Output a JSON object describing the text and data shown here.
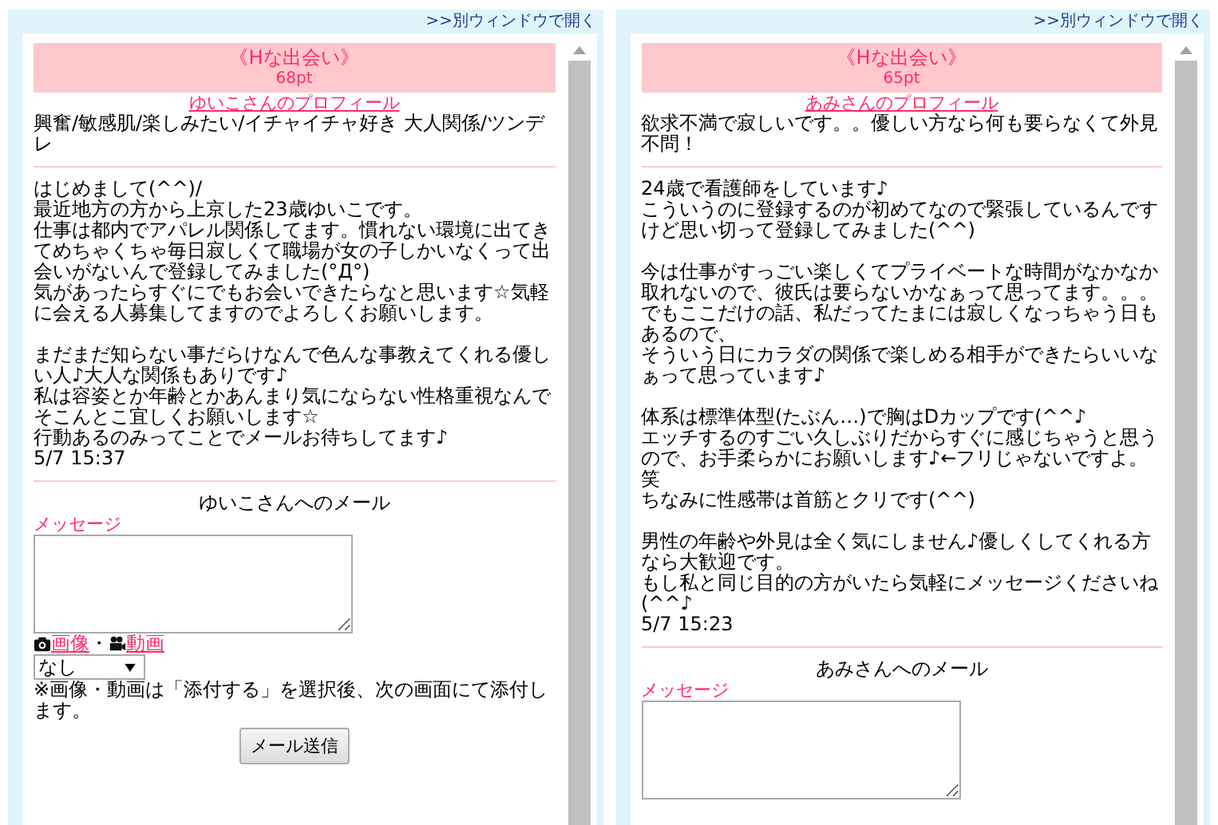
{
  "panels": [
    {
      "open_link": ">>別ウィンドウで開く",
      "banner": {
        "title": "《Hな出会い》",
        "points": "68pt"
      },
      "profile_link": "ゆいこさんのプロフィール",
      "tagline": "興奮/敏感肌/楽しみたい/イチャイチャ好き 大人関係/ツンデレ",
      "paragraphs": [
        [
          "はじめまして(^^)/",
          "最近地方の方から上京した23歳ゆいこです。",
          "仕事は都内でアパレル関係してます。慣れない環境に出てきてめちゃくちゃ毎日寂しくて職場が女の子しかいなくって出会いがないんで登録してみました(°Д°)",
          "気があったらすぐにでもお会いできたらなと思います☆気軽に会える人募集してますのでよろしくお願いします。"
        ],
        [
          "まだまだ知らない事だらけなんで色んな事教えてくれる優しい人♪大人な関係もありです♪",
          "私は容姿とか年齢とかあんまり気にならない性格重視なんでそこんとこ宜しくお願いします☆",
          "行動あるのみってことでメールお待ちしてます♪"
        ]
      ],
      "timestamp": "5/7 15:37",
      "mail": {
        "title": "ゆいこさんへのメール",
        "message_label": "メッセージ",
        "attach": {
          "image_label": "画像",
          "separator": "・",
          "video_label": "動画",
          "select_value": "なし",
          "note": "※画像・動画は「添付する」を選択後、次の画面にて添付します。"
        },
        "send_button": "メール送信"
      }
    },
    {
      "open_link": ">>別ウィンドウで開く",
      "banner": {
        "title": "《Hな出会い》",
        "points": "65pt"
      },
      "profile_link": "あみさんのプロフィール",
      "tagline": "欲求不満で寂しいです。。優しい方なら何も要らなくて外見不問！",
      "paragraphs": [
        [
          "24歳で看護師をしています♪",
          "こういうのに登録するのが初めてなので緊張しているんですけど思い切って登録してみました(^^)"
        ],
        [
          "今は仕事がすっごい楽しくてプライベートな時間がなかなか取れないので、彼氏は要らないかなぁって思ってます。。。",
          "でもここだけの話、私だってたまには寂しくなっちゃう日もあるので、",
          "そういう日にカラダの関係で楽しめる相手ができたらいいなぁって思っています♪"
        ],
        [
          "体系は標準体型(たぶん…)で胸はDカップです(^^♪",
          "エッチするのすごい久しぶりだからすぐに感じちゃうと思うので、お手柔らかにお願いします♪←フリじゃないですよ。笑",
          "ちなみに性感帯は首筋とクリです(^^)"
        ],
        [
          "男性の年齢や外見は全く気にしません♪優しくしてくれる方なら大歓迎です。",
          "もし私と同じ目的の方がいたら気軽にメッセージくださいね(^^♪"
        ]
      ],
      "timestamp": "5/7 15:23",
      "mail": {
        "title": "あみさんへのメール",
        "message_label": "メッセージ"
      }
    }
  ]
}
